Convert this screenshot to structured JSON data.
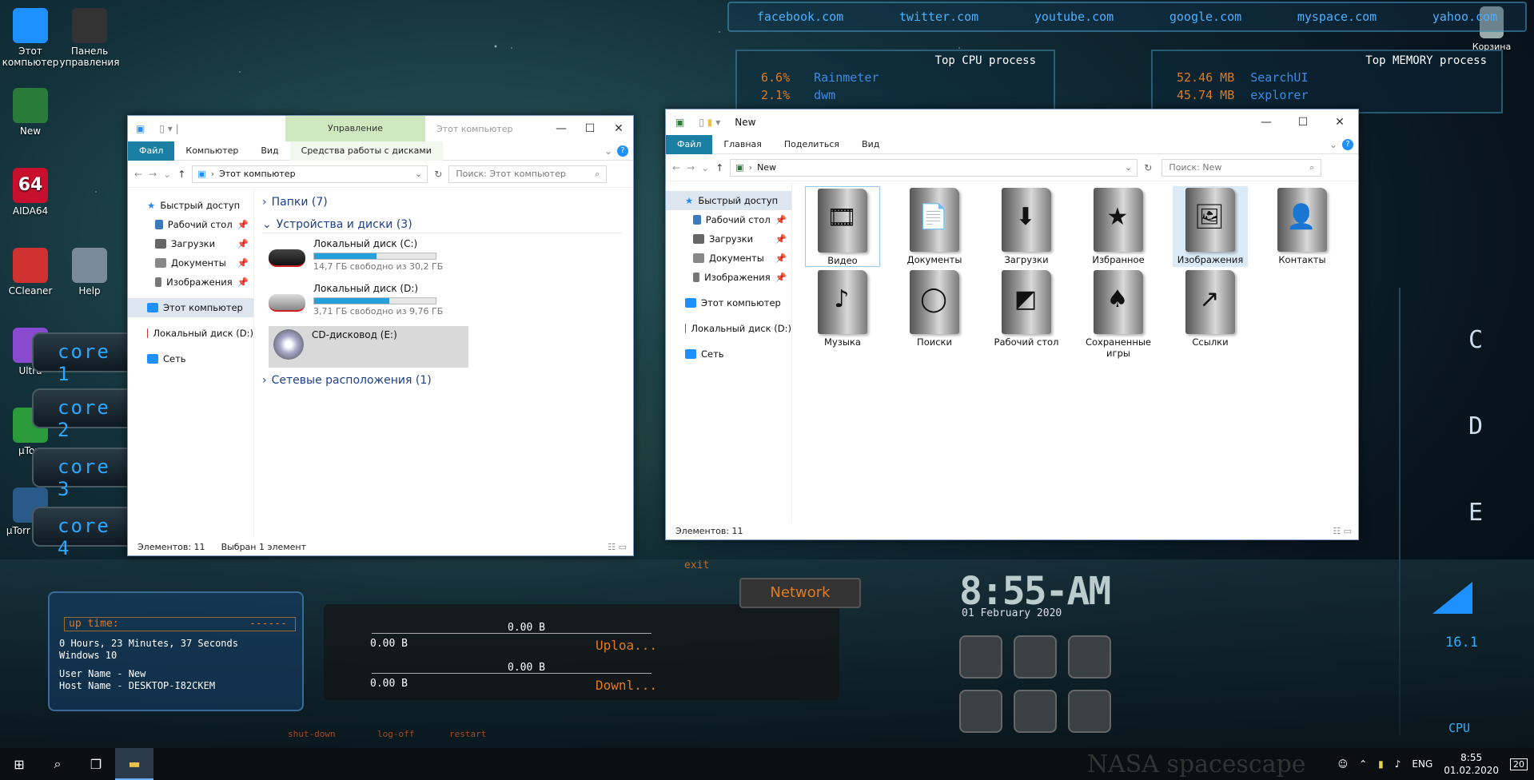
{
  "desktop": {
    "icons": [
      {
        "label": "Этот компьютер",
        "color": "#1e90ff"
      },
      {
        "label": "Панель управления",
        "color": "#333"
      },
      {
        "label": "New",
        "color": "#2a7a3a"
      },
      {
        "label": "AIDA64",
        "color": "#c8102e"
      },
      {
        "label": "CCleaner",
        "color": "#d03030"
      },
      {
        "label": "Help",
        "color": "#7a8a9a"
      },
      {
        "label": "Ultra",
        "color": "#8a4ad0"
      },
      {
        "label": "µTorr",
        "color": "#2a9a3a"
      },
      {
        "label": "µTorr Clea",
        "color": "#2a5a8a"
      }
    ],
    "trash_label": "Корзина"
  },
  "rainmeter": {
    "links": [
      "facebook.com",
      "twitter.com",
      "youtube.com",
      "google.com",
      "myspace.com",
      "yahoo.com"
    ],
    "cpu": {
      "title": "Top CPU process",
      "rows": [
        {
          "val": "6.6%",
          "name": "Rainmeter"
        },
        {
          "val": "2.1%",
          "name": "dwm"
        }
      ]
    },
    "mem": {
      "title": "Top MEMORY process",
      "rows": [
        {
          "val": "52.46 MB",
          "name": "SearchUI"
        },
        {
          "val": "45.74 MB",
          "name": "explorer"
        }
      ]
    },
    "cores": [
      "core 1",
      "core 2",
      "core 3",
      "core 4"
    ],
    "drives": [
      "C",
      "D",
      "E"
    ],
    "uptime": {
      "label": "up time:",
      "dashes": "------",
      "line1": "0 Hours, 23 Minutes, 37 Seconds",
      "line2": "Windows 10",
      "user": "User Name - New",
      "host": "Host Name - DESKTOP-I82CKEM"
    },
    "shutdown": "shut-down",
    "logoff": "log-off",
    "restart": "restart",
    "exit": "exit",
    "network": {
      "title": "Network",
      "up_total": "0.00 B",
      "up_val": "0.00 B",
      "up_label": "Uploa...",
      "down_total": "0.00 B",
      "down_val": "0.00 B",
      "down_label": "Downl..."
    },
    "clock": {
      "time": "8:55-AM",
      "date": "01 February 2020"
    },
    "cpu_gauge": {
      "value": "16.1",
      "label": "CPU"
    },
    "brand": "NASA spacescape"
  },
  "win1": {
    "manage_tab": "Управление",
    "title": "Этот компьютер",
    "tabs": {
      "file": "Файл",
      "computer": "Компьютер",
      "view": "Вид",
      "disk": "Средства работы с дисками"
    },
    "address": "Этот компьютер",
    "search": "Поиск: Этот компьютер",
    "nav": {
      "quick": "Быстрый доступ",
      "desktop": "Рабочий стол",
      "downloads": "Загрузки",
      "docs": "Документы",
      "images": "Изображения",
      "pc": "Этот компьютер",
      "local_d": "Локальный диск (D:)",
      "net": "Сеть"
    },
    "folders_h": "Папки (7)",
    "devices_h": "Устройства и диски (3)",
    "network_h": "Сетевые расположения (1)",
    "drives": [
      {
        "name": "Локальный диск (C:)",
        "free": "14,7 ГБ свободно из 30,2 ГБ",
        "fill": 0.51
      },
      {
        "name": "Локальный диск (D:)",
        "free": "3,71 ГБ свободно из 9,76 ГБ",
        "fill": 0.62
      },
      {
        "name": "CD-дисковод (E:)"
      }
    ],
    "status_items": "Элементов: 11",
    "status_sel": "Выбран 1 элемент"
  },
  "win2": {
    "title": "New",
    "tabs": {
      "file": "Файл",
      "home": "Главная",
      "share": "Поделиться",
      "view": "Вид"
    },
    "address": "New",
    "search": "Поиск: New",
    "nav": {
      "quick": "Быстрый доступ",
      "desktop": "Рабочий стол",
      "downloads": "Загрузки",
      "docs": "Документы",
      "images": "Изображения",
      "pc": "Этот компьютер",
      "local_d": "Локальный диск (D:)",
      "net": "Сеть"
    },
    "folders": [
      {
        "label": "Видео",
        "icon": "film-icon",
        "glyph": "🎞"
      },
      {
        "label": "Документы",
        "icon": "document-icon",
        "glyph": "📄"
      },
      {
        "label": "Загрузки",
        "icon": "download-arrow-icon",
        "glyph": "⬇"
      },
      {
        "label": "Избранное",
        "icon": "star-icon",
        "glyph": "★"
      },
      {
        "label": "Изображения",
        "icon": "picture-icon",
        "glyph": "🖼"
      },
      {
        "label": "Контакты",
        "icon": "contact-icon",
        "glyph": "👤"
      },
      {
        "label": "Музыка",
        "icon": "music-note-icon",
        "glyph": "♪"
      },
      {
        "label": "Поиски",
        "icon": "search-circle-icon",
        "glyph": "◯"
      },
      {
        "label": "Рабочий стол",
        "icon": "desktop-icon",
        "glyph": "◩"
      },
      {
        "label": "Сохраненные игры",
        "icon": "spade-icon",
        "glyph": "♠"
      },
      {
        "label": "Ссылки",
        "icon": "link-arrow-icon",
        "glyph": "↗"
      }
    ],
    "status_items": "Элементов: 11"
  },
  "taskbar": {
    "lang": "ENG",
    "time": "8:55",
    "date": "01.02.2020",
    "notif": "20"
  }
}
